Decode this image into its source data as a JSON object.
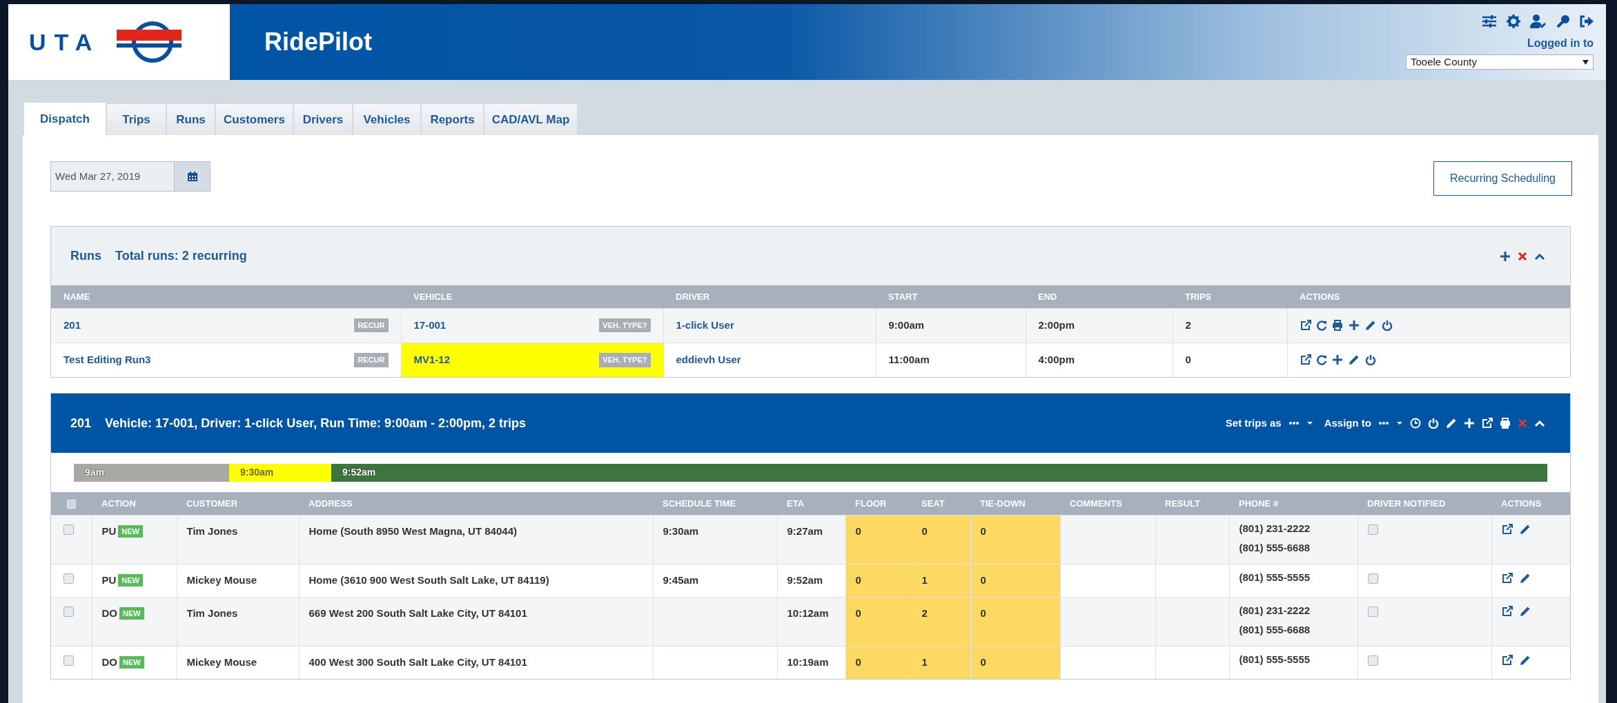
{
  "header": {
    "logo_text": "UTA",
    "app_title": "RidePilot",
    "logged_in_label": "Logged in to",
    "provider_select": {
      "value": "Tooele County"
    }
  },
  "tabs": [
    {
      "label": "Dispatch",
      "selected": true
    },
    {
      "label": "Trips",
      "selected": false
    },
    {
      "label": "Runs",
      "selected": false
    },
    {
      "label": "Customers",
      "selected": false
    },
    {
      "label": "Drivers",
      "selected": false
    },
    {
      "label": "Vehicles",
      "selected": false
    },
    {
      "label": "Reports",
      "selected": false
    },
    {
      "label": "CAD/AVL Map",
      "selected": false
    }
  ],
  "date_field": {
    "value": "Wed Mar 27, 2019"
  },
  "recurring_button": "Recurring Scheduling",
  "runs_panel": {
    "title": "Runs",
    "summary": "Total runs: 2 recurring",
    "columns": [
      "NAME",
      "VEHICLE",
      "DRIVER",
      "START",
      "END",
      "TRIPS",
      "ACTIONS"
    ],
    "rows": [
      {
        "name": "201",
        "badge": "RECUR",
        "vehicle": "17-001",
        "vehicle_highlighted": false,
        "vehicle_badge": "VEH. TYPE?",
        "driver": "1-click User",
        "start": "9:00am",
        "end": "2:00pm",
        "trips": "2",
        "print_action": true
      },
      {
        "name": "Test Editing Run3",
        "badge": "RECUR",
        "vehicle": "MV1-12",
        "vehicle_highlighted": true,
        "vehicle_badge": "VEH. TYPE?",
        "driver": "eddievh User",
        "start": "11:00am",
        "end": "4:00pm",
        "trips": "0",
        "print_action": false
      }
    ]
  },
  "run_detail": {
    "run": "201",
    "summary": "Vehicle: 17-001, Driver: 1-click User, Run Time: 9:00am - 2:00pm, 2 trips",
    "set_trips_label": "Set trips as",
    "select_all_checked": false,
    "assign_label": "Assign to",
    "timeline": [
      {
        "label": "9am",
        "color": "#a6a9a4"
      },
      {
        "label": "9:30am",
        "color": "#ffff00"
      },
      {
        "label": "9:52am",
        "color": "#3d763d"
      }
    ],
    "columns": [
      "ACTION",
      "CUSTOMER",
      "ADDRESS",
      "SCHEDULE TIME",
      "ETA",
      "FLOOR",
      "SEAT",
      "TIE-DOWN",
      "COMMENTS",
      "RESULT",
      "PHONE #",
      "DRIVER NOTIFIED",
      "ACTIONS"
    ],
    "rows": [
      {
        "checked": false,
        "action": "PU",
        "badge": "NEW",
        "customer": "Tim Jones",
        "address": "Home (South 8950 West Magna, UT 84044)",
        "schedule_time": "9:30am",
        "eta": "9:27am",
        "floor": "0",
        "seat": "0",
        "tie_down": "0",
        "phones": [
          "(801) 231-2222",
          "(801) 555-6688"
        ],
        "driver_notified": false
      },
      {
        "checked": false,
        "action": "PU",
        "badge": "NEW",
        "customer": "Mickey Mouse",
        "address": "Home (3610 900 West South Salt Lake, UT 84119)",
        "schedule_time": "9:45am",
        "eta": "9:52am",
        "floor": "0",
        "seat": "1",
        "tie_down": "0",
        "phones": [
          "(801) 555-5555"
        ],
        "driver_notified": false
      },
      {
        "checked": false,
        "action": "DO",
        "badge": "NEW",
        "customer": "Tim Jones",
        "address": "669 West 200 South Salt Lake City, UT 84101",
        "eta": "10:12am",
        "floor": "0",
        "seat": "2",
        "tie_down": "0",
        "phones": [
          "(801) 231-2222",
          "(801) 555-6688"
        ],
        "driver_notified": false
      },
      {
        "checked": false,
        "action": "DO",
        "badge": "NEW",
        "customer": "Mickey Mouse",
        "address": "400 West 300 South Salt Lake City, UT 84101",
        "eta": "10:19am",
        "floor": "0",
        "seat": "1",
        "tie_down": "0",
        "phones": [
          "(801) 555-5555"
        ],
        "driver_notified": false
      }
    ]
  }
}
